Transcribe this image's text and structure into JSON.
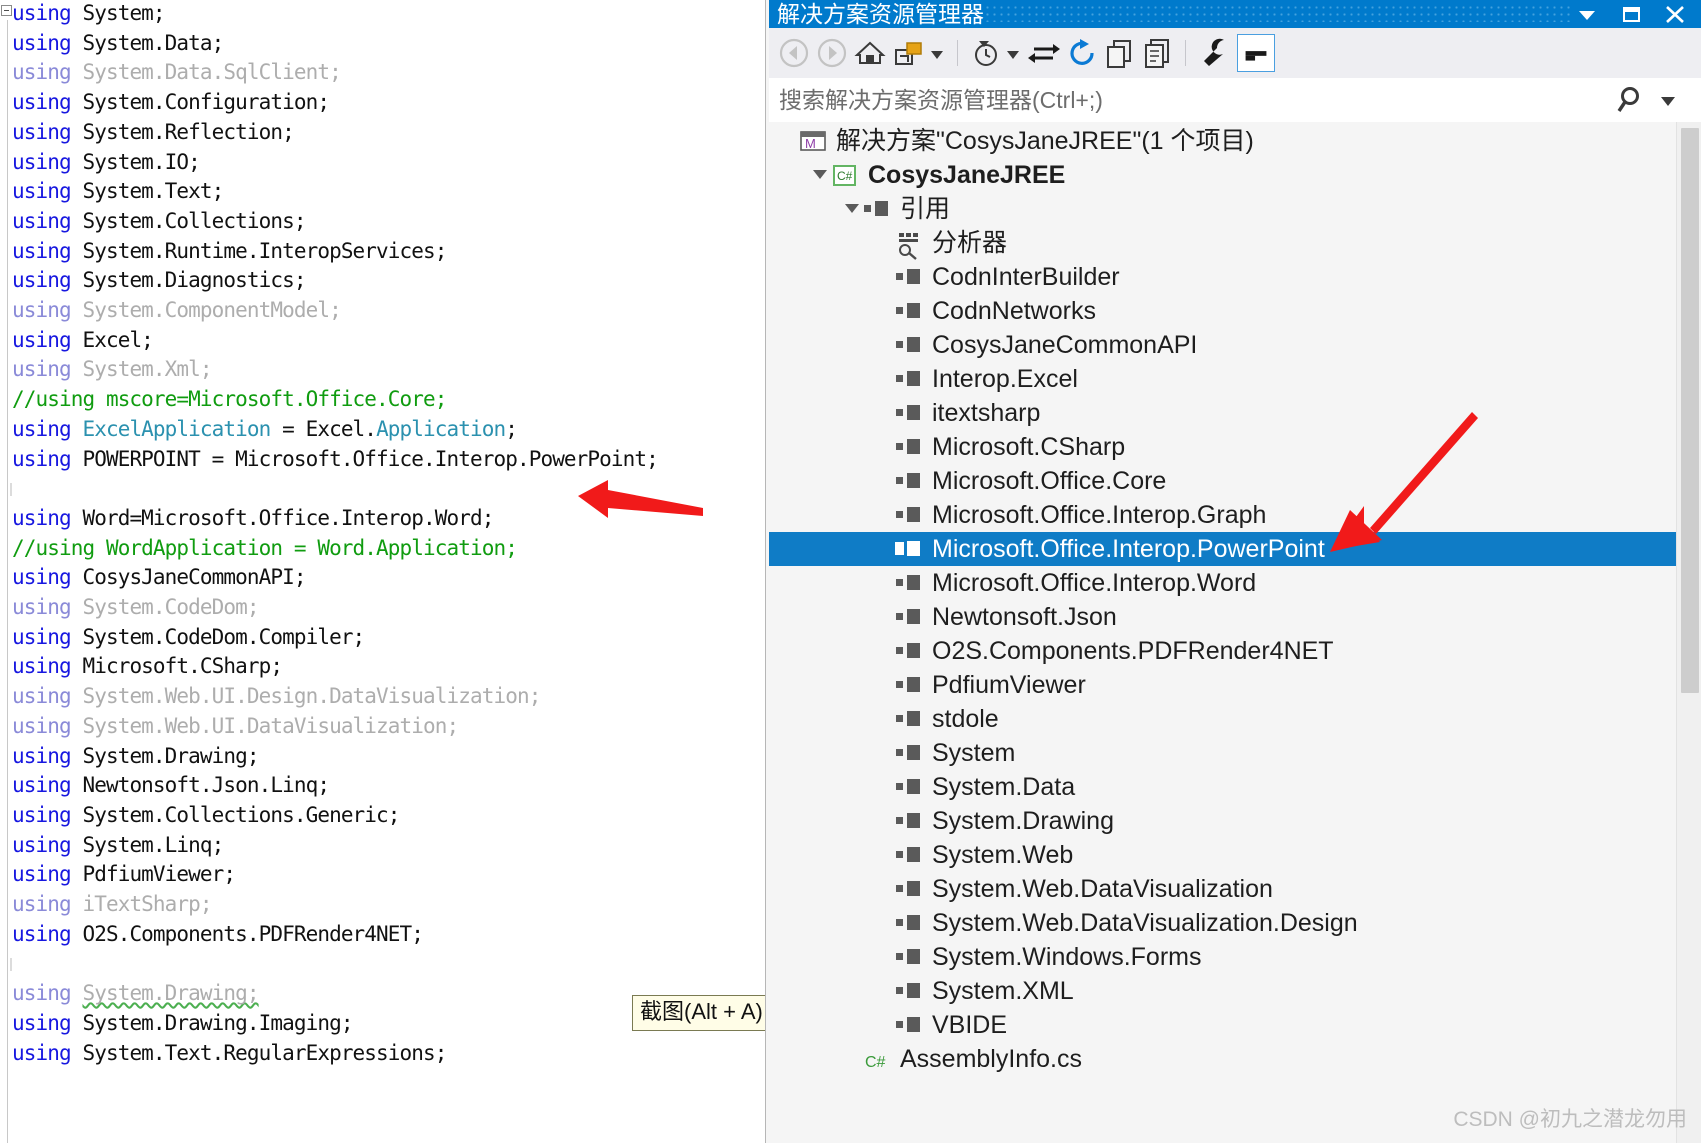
{
  "editor": {
    "lines": [
      {
        "t": "code",
        "y": 0,
        "spans": [
          {
            "c": "kw",
            "x": "using "
          },
          {
            "c": "plain",
            "x": "System;"
          }
        ]
      },
      {
        "t": "code",
        "y": 1,
        "spans": [
          {
            "c": "kw",
            "x": "using "
          },
          {
            "c": "plain",
            "x": "System.Data;"
          }
        ]
      },
      {
        "t": "code",
        "y": 2,
        "spans": [
          {
            "c": "kw-d",
            "x": "using "
          },
          {
            "c": "dim",
            "x": "System.Data.SqlClient;"
          }
        ]
      },
      {
        "t": "code",
        "y": 3,
        "spans": [
          {
            "c": "kw",
            "x": "using "
          },
          {
            "c": "plain",
            "x": "System.Configuration;"
          }
        ]
      },
      {
        "t": "code",
        "y": 4,
        "spans": [
          {
            "c": "kw",
            "x": "using "
          },
          {
            "c": "plain",
            "x": "System.Reflection;"
          }
        ]
      },
      {
        "t": "code",
        "y": 5,
        "spans": [
          {
            "c": "kw",
            "x": "using "
          },
          {
            "c": "plain",
            "x": "System.IO;"
          }
        ]
      },
      {
        "t": "code",
        "y": 6,
        "spans": [
          {
            "c": "kw",
            "x": "using "
          },
          {
            "c": "plain",
            "x": "System.Text;"
          }
        ]
      },
      {
        "t": "code",
        "y": 7,
        "spans": [
          {
            "c": "kw",
            "x": "using "
          },
          {
            "c": "plain",
            "x": "System.Collections;"
          }
        ]
      },
      {
        "t": "code",
        "y": 8,
        "spans": [
          {
            "c": "kw",
            "x": "using "
          },
          {
            "c": "plain",
            "x": "System.Runtime.InteropServices;"
          }
        ]
      },
      {
        "t": "code",
        "y": 9,
        "spans": [
          {
            "c": "kw",
            "x": "using "
          },
          {
            "c": "plain",
            "x": "System.Diagnostics;"
          }
        ]
      },
      {
        "t": "code",
        "y": 10,
        "spans": [
          {
            "c": "kw-d",
            "x": "using "
          },
          {
            "c": "dim",
            "x": "System.ComponentModel;"
          }
        ]
      },
      {
        "t": "code",
        "y": 11,
        "spans": [
          {
            "c": "kw",
            "x": "using "
          },
          {
            "c": "plain",
            "x": "Excel;"
          }
        ]
      },
      {
        "t": "code",
        "y": 12,
        "spans": [
          {
            "c": "kw-d",
            "x": "using "
          },
          {
            "c": "dim",
            "x": "System.Xml;"
          }
        ]
      },
      {
        "t": "code",
        "y": 13,
        "spans": [
          {
            "c": "cmt",
            "x": "//using mscore=Microsoft.Office.Core;"
          }
        ]
      },
      {
        "t": "code",
        "y": 14,
        "spans": [
          {
            "c": "kw",
            "x": "using "
          },
          {
            "c": "type",
            "x": "ExcelApplication"
          },
          {
            "c": "plain",
            "x": " = Excel."
          },
          {
            "c": "type",
            "x": "Application"
          },
          {
            "c": "plain",
            "x": ";"
          }
        ]
      },
      {
        "t": "code",
        "y": 15,
        "spans": [
          {
            "c": "kw",
            "x": "using "
          },
          {
            "c": "plain",
            "x": "POWERPOINT = Microsoft.Office.Interop.PowerPoint;"
          }
        ]
      },
      {
        "t": "blank",
        "y": 16
      },
      {
        "t": "code",
        "y": 17,
        "spans": [
          {
            "c": "kw",
            "x": "using "
          },
          {
            "c": "plain",
            "x": "Word=Microsoft.Office.Interop.Word;"
          }
        ]
      },
      {
        "t": "code",
        "y": 18,
        "spans": [
          {
            "c": "cmt",
            "x": "//using WordApplication = Word.Application;"
          }
        ]
      },
      {
        "t": "code",
        "y": 19,
        "spans": [
          {
            "c": "kw",
            "x": "using "
          },
          {
            "c": "plain",
            "x": "CosysJaneCommonAPI;"
          }
        ]
      },
      {
        "t": "code",
        "y": 20,
        "spans": [
          {
            "c": "kw-d",
            "x": "using "
          },
          {
            "c": "dim",
            "x": "System.CodeDom;"
          }
        ]
      },
      {
        "t": "code",
        "y": 21,
        "spans": [
          {
            "c": "kw",
            "x": "using "
          },
          {
            "c": "plain",
            "x": "System.CodeDom.Compiler;"
          }
        ]
      },
      {
        "t": "code",
        "y": 22,
        "spans": [
          {
            "c": "kw",
            "x": "using "
          },
          {
            "c": "plain",
            "x": "Microsoft.CSharp;"
          }
        ]
      },
      {
        "t": "code",
        "y": 23,
        "spans": [
          {
            "c": "kw-d",
            "x": "using "
          },
          {
            "c": "dim",
            "x": "System.Web.UI.Design.DataVisualization;"
          }
        ]
      },
      {
        "t": "code",
        "y": 24,
        "spans": [
          {
            "c": "kw-d",
            "x": "using "
          },
          {
            "c": "dim",
            "x": "System.Web.UI.DataVisualization;"
          }
        ]
      },
      {
        "t": "code",
        "y": 25,
        "spans": [
          {
            "c": "kw",
            "x": "using "
          },
          {
            "c": "plain",
            "x": "System.Drawing;"
          }
        ]
      },
      {
        "t": "code",
        "y": 26,
        "spans": [
          {
            "c": "kw",
            "x": "using "
          },
          {
            "c": "plain",
            "x": "Newtonsoft.Json.Linq;"
          }
        ]
      },
      {
        "t": "code",
        "y": 27,
        "spans": [
          {
            "c": "kw",
            "x": "using "
          },
          {
            "c": "plain",
            "x": "System.Collections.Generic;"
          }
        ]
      },
      {
        "t": "code",
        "y": 28,
        "spans": [
          {
            "c": "kw",
            "x": "using "
          },
          {
            "c": "plain",
            "x": "System.Linq;"
          }
        ]
      },
      {
        "t": "code",
        "y": 29,
        "spans": [
          {
            "c": "kw",
            "x": "using "
          },
          {
            "c": "plain",
            "x": "PdfiumViewer;"
          }
        ]
      },
      {
        "t": "code",
        "y": 30,
        "spans": [
          {
            "c": "kw-d",
            "x": "using "
          },
          {
            "c": "dim",
            "x": "iTextSharp;"
          }
        ]
      },
      {
        "t": "code",
        "y": 31,
        "spans": [
          {
            "c": "kw",
            "x": "using "
          },
          {
            "c": "plain",
            "x": "O2S.Components.PDFRender4NET;"
          }
        ]
      },
      {
        "t": "blank",
        "y": 32
      },
      {
        "t": "code",
        "y": 33,
        "spans": [
          {
            "c": "kw-d",
            "x": "using "
          },
          {
            "c": "dim squiggle",
            "x": "System.Drawing;"
          }
        ]
      },
      {
        "t": "code",
        "y": 34,
        "spans": [
          {
            "c": "kw",
            "x": "using "
          },
          {
            "c": "plain",
            "x": "System.Drawing.Imaging;"
          }
        ]
      },
      {
        "t": "code",
        "y": 35,
        "spans": [
          {
            "c": "kw",
            "x": "using "
          },
          {
            "c": "plain",
            "x": "System.Text.RegularExpressions;"
          }
        ]
      }
    ]
  },
  "snip_tooltip": {
    "label": "截图(Alt + A)"
  },
  "solution_explorer": {
    "title": "解决方案资源管理器",
    "window_buttons": [
      {
        "name": "dropdown-button",
        "glyph": "▼"
      },
      {
        "name": "maximize-button",
        "glyph": "▢"
      },
      {
        "name": "close-button",
        "glyph": "✕"
      }
    ],
    "toolbar": [
      {
        "name": "back-button",
        "icon": "back-arrow-icon",
        "disabled": true
      },
      {
        "name": "forward-button",
        "icon": "forward-arrow-icon",
        "disabled": true
      },
      {
        "name": "home-button",
        "icon": "home-icon"
      },
      {
        "name": "solution-view-button",
        "icon": "solution-folder-icon"
      },
      {
        "name": "solution-view-dropdown",
        "icon": "chevron-down-icon"
      },
      {
        "name": "pending-changes-button",
        "icon": "clock-icon"
      },
      {
        "name": "pending-changes-dropdown",
        "icon": "chevron-down-icon"
      },
      {
        "name": "sync-with-active-document-button",
        "icon": "sync-arrows-icon"
      },
      {
        "name": "refresh-button",
        "icon": "refresh-icon"
      },
      {
        "name": "show-all-files-button",
        "icon": "copy-files-icon"
      },
      {
        "name": "preview-selected-items-button",
        "icon": "document-copy-icon"
      },
      {
        "name": "properties-button",
        "icon": "wrench-icon"
      },
      {
        "name": "collapse-all-button",
        "icon": "collapse-icon",
        "active": true
      }
    ],
    "search": {
      "placeholder": "搜索解决方案资源管理器(Ctrl+;)",
      "search_icon": "search-icon",
      "dropdown_icon": "chevron-down-icon"
    },
    "tree": [
      {
        "indent": 0,
        "icon": "solution-icon",
        "label": "解决方案\"CosysJaneJREE\"(1 个项目)",
        "expander": "none",
        "bold": false,
        "selected": false
      },
      {
        "indent": 1,
        "icon": "csharp-project-icon",
        "label": "CosysJaneJREE",
        "expander": "open",
        "bold": true,
        "selected": false
      },
      {
        "indent": 2,
        "icon": "reference-icon",
        "label": "引用",
        "expander": "open",
        "bold": false,
        "selected": false
      },
      {
        "indent": 3,
        "icon": "analyzer-icon",
        "label": "分析器",
        "expander": "none",
        "bold": false,
        "selected": false
      },
      {
        "indent": 3,
        "icon": "reference-icon",
        "label": "CodnInterBuilder",
        "expander": "none",
        "bold": false,
        "selected": false
      },
      {
        "indent": 3,
        "icon": "reference-icon",
        "label": "CodnNetworks",
        "expander": "none",
        "bold": false,
        "selected": false
      },
      {
        "indent": 3,
        "icon": "reference-icon",
        "label": "CosysJaneCommonAPI",
        "expander": "none",
        "bold": false,
        "selected": false
      },
      {
        "indent": 3,
        "icon": "reference-icon",
        "label": "Interop.Excel",
        "expander": "none",
        "bold": false,
        "selected": false
      },
      {
        "indent": 3,
        "icon": "reference-icon",
        "label": "itextsharp",
        "expander": "none",
        "bold": false,
        "selected": false
      },
      {
        "indent": 3,
        "icon": "reference-icon",
        "label": "Microsoft.CSharp",
        "expander": "none",
        "bold": false,
        "selected": false
      },
      {
        "indent": 3,
        "icon": "reference-icon",
        "label": "Microsoft.Office.Core",
        "expander": "none",
        "bold": false,
        "selected": false
      },
      {
        "indent": 3,
        "icon": "reference-icon",
        "label": "Microsoft.Office.Interop.Graph",
        "expander": "none",
        "bold": false,
        "selected": false
      },
      {
        "indent": 3,
        "icon": "reference-icon",
        "label": "Microsoft.Office.Interop.PowerPoint",
        "expander": "none",
        "bold": false,
        "selected": true
      },
      {
        "indent": 3,
        "icon": "reference-icon",
        "label": "Microsoft.Office.Interop.Word",
        "expander": "none",
        "bold": false,
        "selected": false
      },
      {
        "indent": 3,
        "icon": "reference-icon",
        "label": "Newtonsoft.Json",
        "expander": "none",
        "bold": false,
        "selected": false
      },
      {
        "indent": 3,
        "icon": "reference-icon",
        "label": "O2S.Components.PDFRender4NET",
        "expander": "none",
        "bold": false,
        "selected": false
      },
      {
        "indent": 3,
        "icon": "reference-icon",
        "label": "PdfiumViewer",
        "expander": "none",
        "bold": false,
        "selected": false
      },
      {
        "indent": 3,
        "icon": "reference-icon",
        "label": "stdole",
        "expander": "none",
        "bold": false,
        "selected": false
      },
      {
        "indent": 3,
        "icon": "reference-icon",
        "label": "System",
        "expander": "none",
        "bold": false,
        "selected": false
      },
      {
        "indent": 3,
        "icon": "reference-icon",
        "label": "System.Data",
        "expander": "none",
        "bold": false,
        "selected": false
      },
      {
        "indent": 3,
        "icon": "reference-icon",
        "label": "System.Drawing",
        "expander": "none",
        "bold": false,
        "selected": false
      },
      {
        "indent": 3,
        "icon": "reference-icon",
        "label": "System.Web",
        "expander": "none",
        "bold": false,
        "selected": false
      },
      {
        "indent": 3,
        "icon": "reference-icon",
        "label": "System.Web.DataVisualization",
        "expander": "none",
        "bold": false,
        "selected": false
      },
      {
        "indent": 3,
        "icon": "reference-icon",
        "label": "System.Web.DataVisualization.Design",
        "expander": "none",
        "bold": false,
        "selected": false
      },
      {
        "indent": 3,
        "icon": "reference-icon",
        "label": "System.Windows.Forms",
        "expander": "none",
        "bold": false,
        "selected": false
      },
      {
        "indent": 3,
        "icon": "reference-icon",
        "label": "System.XML",
        "expander": "none",
        "bold": false,
        "selected": false
      },
      {
        "indent": 3,
        "icon": "reference-icon",
        "label": "VBIDE",
        "expander": "none",
        "bold": false,
        "selected": false
      },
      {
        "indent": 2,
        "icon": "csharp-file-icon",
        "label": "AssemblyInfo.cs",
        "expander": "none",
        "bold": false,
        "selected": false
      }
    ]
  },
  "watermark": {
    "text": "CSDN @初九之潜龙勿用"
  },
  "colors": {
    "titlebar": "#007acc",
    "selection": "#0f7cc6",
    "arrow_red": "#f11a1a",
    "tooltip_bg": "#fffde7"
  }
}
